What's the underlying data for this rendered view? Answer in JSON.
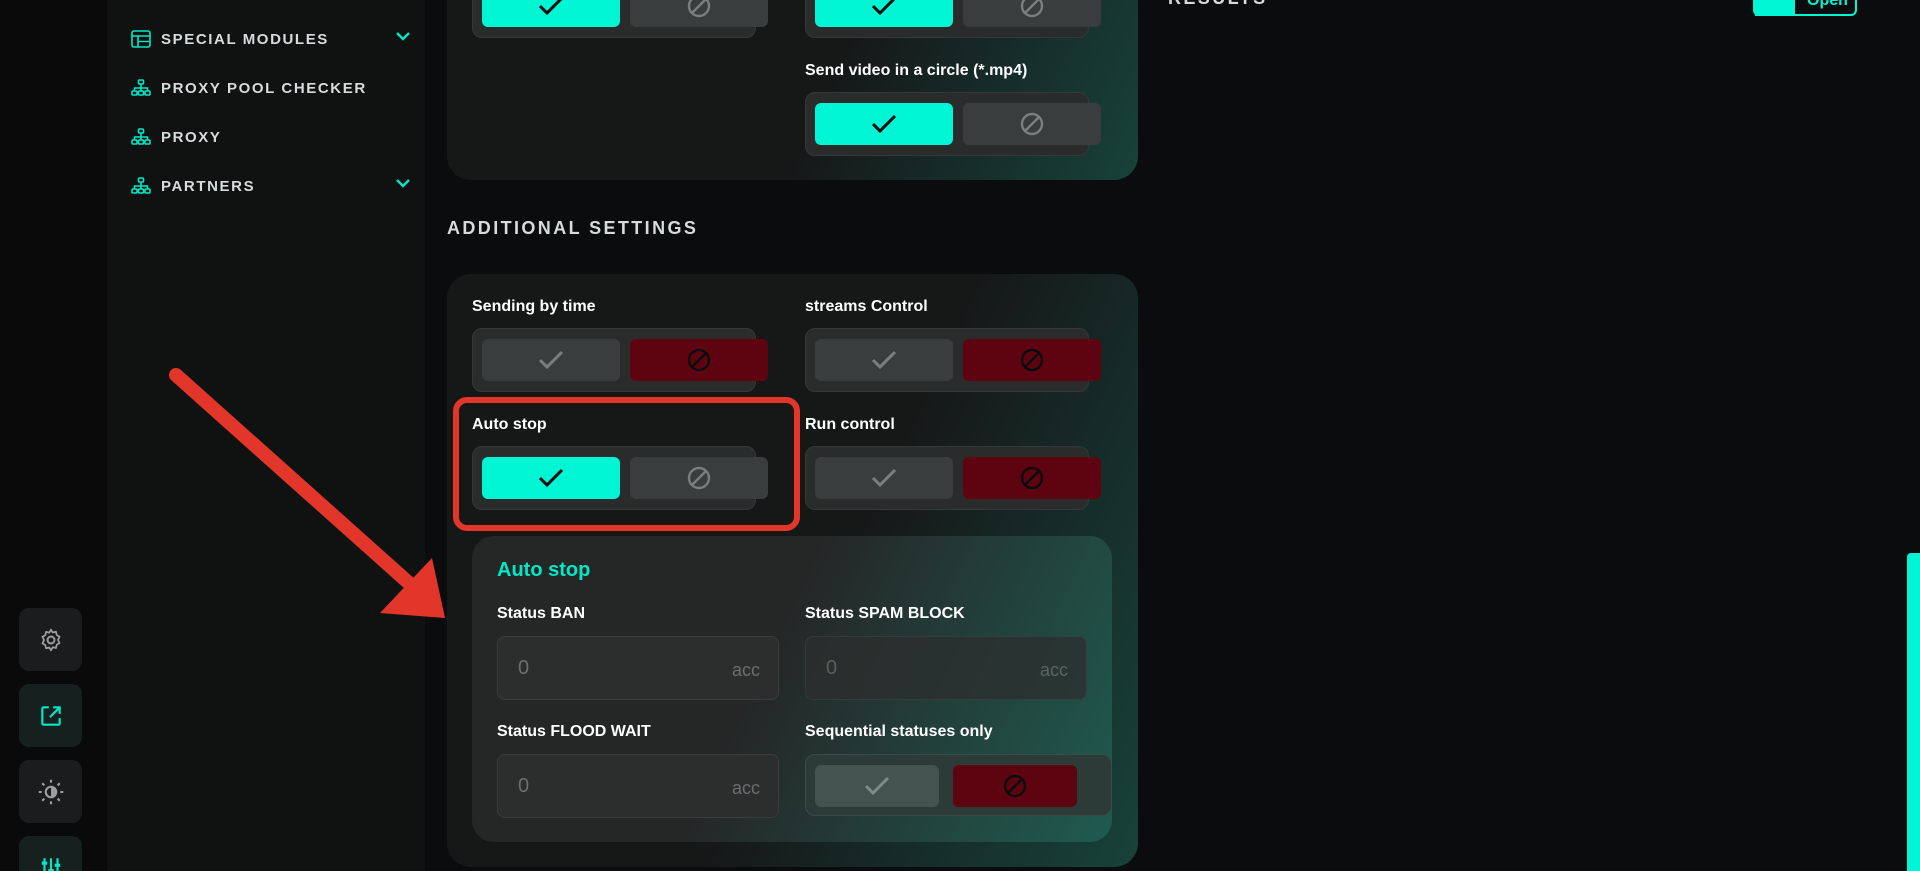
{
  "sidebar": {
    "items": [
      {
        "label": "SPECIAL MODULES",
        "icon": "table-icon",
        "has_submenu": true
      },
      {
        "label": "PROXY POOL CHECKER",
        "icon": "network-icon",
        "has_submenu": false
      },
      {
        "label": "PROXY",
        "icon": "network-icon",
        "has_submenu": false
      },
      {
        "label": "PARTNERS",
        "icon": "network-icon",
        "has_submenu": true
      }
    ]
  },
  "rail": {
    "buttons": [
      "gear-icon",
      "external-link-icon",
      "theme-icon",
      "sliders-icon"
    ]
  },
  "top_card": {
    "send_video_label": "Send video in a circle (*.mp4)"
  },
  "results": {
    "title": "RESULTS",
    "open_label": "Open"
  },
  "additional": {
    "title": "ADDITIONAL SETTINGS",
    "sending_by_time": {
      "label": "Sending by time",
      "enabled": false
    },
    "streams_control": {
      "label": "streams Control",
      "enabled": false
    },
    "auto_stop": {
      "label": "Auto stop",
      "enabled": true
    },
    "run_control": {
      "label": "Run control",
      "enabled": false
    }
  },
  "auto_stop_panel": {
    "title": "Auto stop",
    "status_ban": {
      "label": "Status BAN",
      "value": "0",
      "unit": "acc"
    },
    "status_spam_block": {
      "label": "Status SPAM BLOCK",
      "value": "0",
      "unit": "acc"
    },
    "status_flood_wait": {
      "label": "Status FLOOD WAIT",
      "value": "0",
      "unit": "acc"
    },
    "sequential_only": {
      "label": "Sequential statuses only",
      "enabled": false
    }
  },
  "colors": {
    "accent": "#00f5d4",
    "danger": "#5e0410",
    "highlight": "#e3362b"
  }
}
